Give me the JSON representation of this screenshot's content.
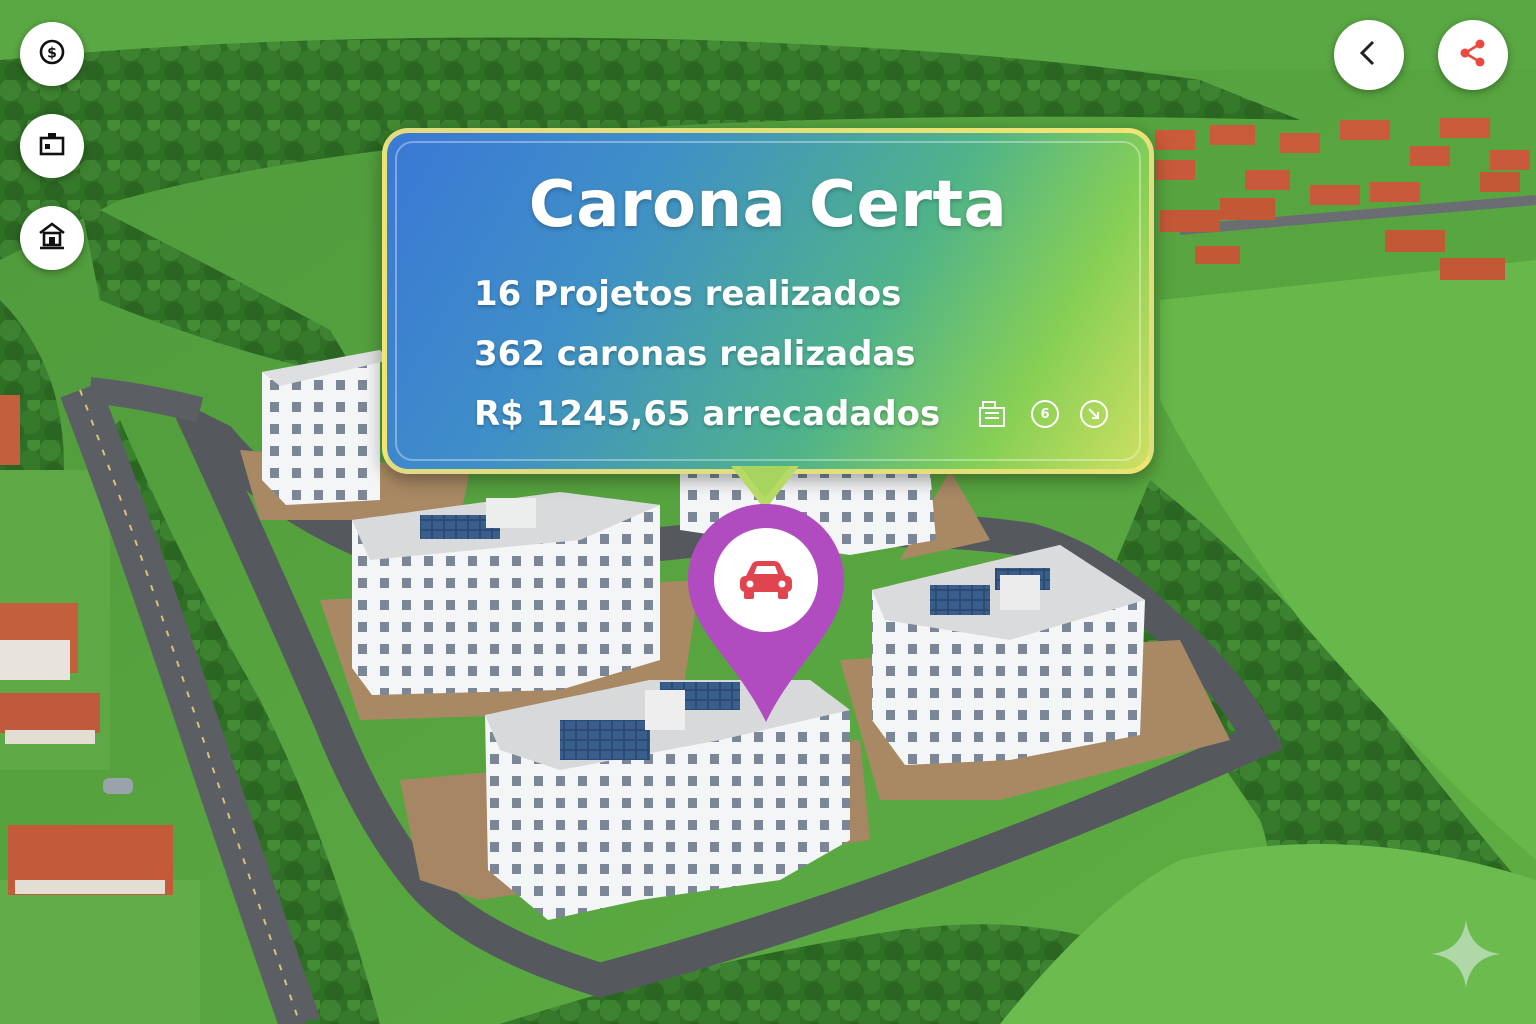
{
  "popup": {
    "title": "Carona Certa",
    "stats": [
      "16 Projetos realizados",
      "362 caronas realizadas",
      "R$ 1245,65 arrecadados"
    ],
    "badge_number": "6",
    "icons": [
      "building-icon",
      "number-badge-icon",
      "arrow-circle-icon"
    ]
  },
  "left_toolbar": {
    "buttons": [
      "dollar-icon",
      "camera-icon",
      "home-icon"
    ]
  },
  "top_right": {
    "buttons": [
      "back-chevron-icon",
      "share-icon"
    ]
  },
  "map_pin": {
    "icon": "car-icon",
    "color": "#b04cc0"
  },
  "colors": {
    "pin": "#b04cc0",
    "car": "#e0444e",
    "share": "#e84a3f",
    "gradient_start": "#3a78d6",
    "gradient_end": "#cfe062"
  }
}
